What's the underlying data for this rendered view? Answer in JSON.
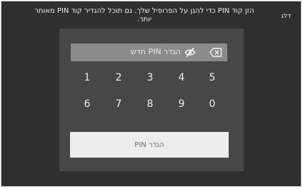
{
  "header": {
    "skip_label": "דלג",
    "instructions": "הזן קוד PIN כדי להגן על הפרופיל שלך. גם תוכל להגדיר קוד PIN מאוחר יותר."
  },
  "pin_input": {
    "placeholder": "הגדר PIN חדש",
    "visibility_icon": "eye-off-icon",
    "clear_icon": "backspace-icon"
  },
  "keypad": {
    "row1": [
      "1",
      "2",
      "3",
      "4",
      "5"
    ],
    "row2": [
      "6",
      "7",
      "8",
      "9",
      "0"
    ]
  },
  "actions": {
    "set_pin_label": "הגדר PIN"
  },
  "colors": {
    "screen_background": "#2f2f2f",
    "dialog_background": "#474747",
    "input_background": "#8b8b8b",
    "button_background": "#ededed"
  }
}
